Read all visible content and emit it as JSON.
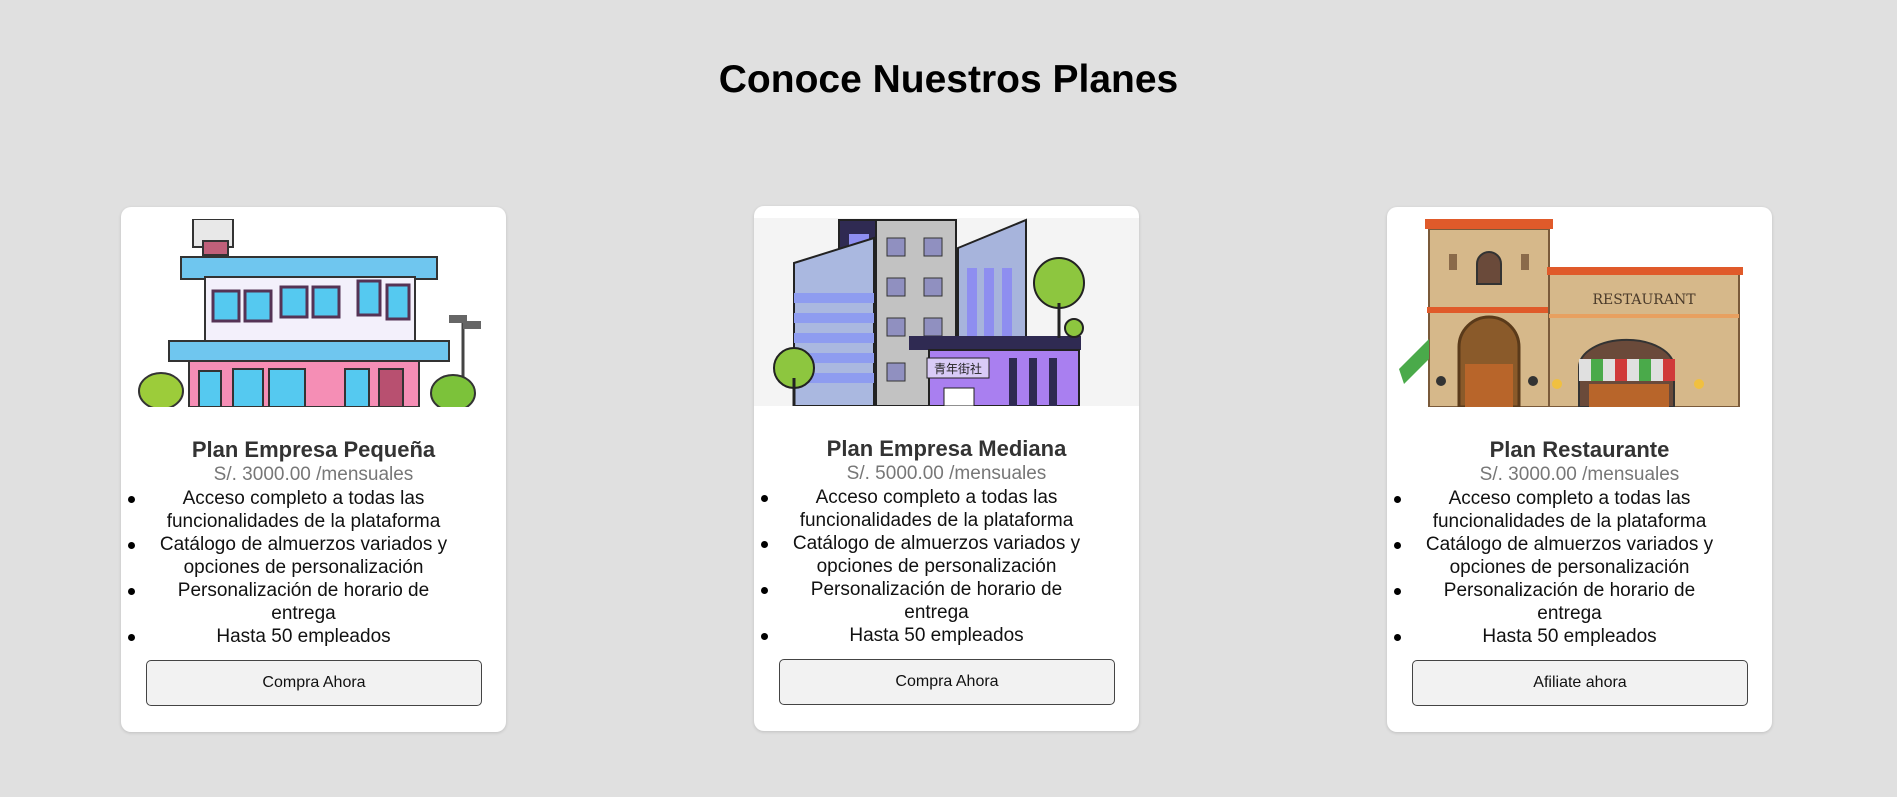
{
  "page": {
    "title": "Conoce Nuestros Planes"
  },
  "plans": [
    {
      "name": "Plan Empresa Pequeña",
      "price": "S/. 3000.00 /mensuales",
      "image_icon": "small-office-building-illustration",
      "features": [
        "Acceso completo a todas las funcionalidades de la plataforma",
        "Catálogo de almuerzos variados y opciones de personalización",
        "Personalización de horario de entrega",
        "Hasta 50 empleados"
      ],
      "button": "Compra Ahora"
    },
    {
      "name": "Plan Empresa Mediana",
      "price": "S/. 5000.00 /mensuales",
      "image_icon": "medium-office-buildings-illustration",
      "image_sign": "青年街社",
      "features": [
        "Acceso completo a todas las funcionalidades de la plataforma",
        "Catálogo de almuerzos variados y opciones de personalización",
        "Personalización de horario de entrega",
        "Hasta 50 empleados"
      ],
      "button": "Compra Ahora"
    },
    {
      "name": "Plan Restaurante",
      "price": "S/. 3000.00 /mensuales",
      "image_icon": "restaurant-building-illustration",
      "image_sign": "RESTAURANT",
      "features": [
        "Acceso completo a todas las funcionalidades de la plataforma",
        "Catálogo de almuerzos variados y opciones de personalización",
        "Personalización de horario de entrega",
        "Hasta 50 empleados"
      ],
      "button": "Afiliate ahora"
    }
  ]
}
